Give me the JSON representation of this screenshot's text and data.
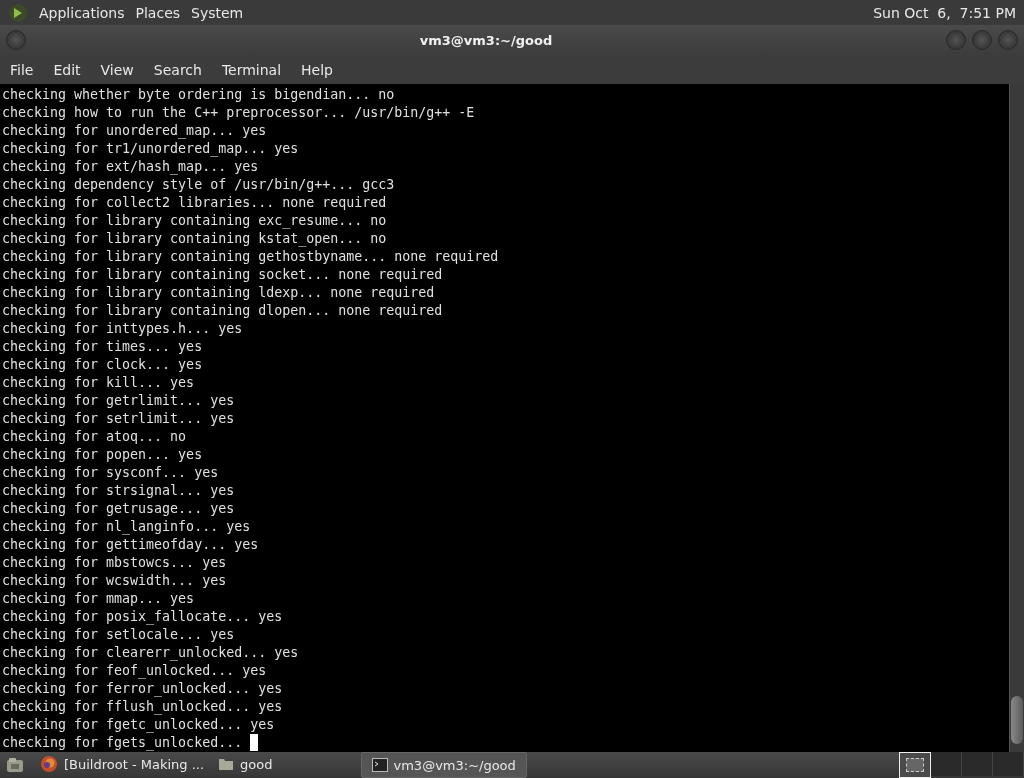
{
  "top_panel": {
    "menus": [
      "Applications",
      "Places",
      "System"
    ],
    "clock": "Sun Oct  6,  7:51 PM"
  },
  "window": {
    "title": "vm3@vm3:~/good"
  },
  "menu_bar": [
    "File",
    "Edit",
    "View",
    "Search",
    "Terminal",
    "Help"
  ],
  "terminal": {
    "cursor_visible": true,
    "lines": [
      "checking whether byte ordering is bigendian... no",
      "checking how to run the C++ preprocessor... /usr/bin/g++ -E",
      "checking for unordered_map... yes",
      "checking for tr1/unordered_map... yes",
      "checking for ext/hash_map... yes",
      "checking dependency style of /usr/bin/g++... gcc3",
      "checking for collect2 libraries... none required",
      "checking for library containing exc_resume... no",
      "checking for library containing kstat_open... no",
      "checking for library containing gethostbyname... none required",
      "checking for library containing socket... none required",
      "checking for library containing ldexp... none required",
      "checking for library containing dlopen... none required",
      "checking for inttypes.h... yes",
      "checking for times... yes",
      "checking for clock... yes",
      "checking for kill... yes",
      "checking for getrlimit... yes",
      "checking for setrlimit... yes",
      "checking for atoq... no",
      "checking for popen... yes",
      "checking for sysconf... yes",
      "checking for strsignal... yes",
      "checking for getrusage... yes",
      "checking for nl_langinfo... yes",
      "checking for gettimeofday... yes",
      "checking for mbstowcs... yes",
      "checking for wcswidth... yes",
      "checking for mmap... yes",
      "checking for posix_fallocate... yes",
      "checking for setlocale... yes",
      "checking for clearerr_unlocked... yes",
      "checking for feof_unlocked... yes",
      "checking for ferror_unlocked... yes",
      "checking for fflush_unlocked... yes",
      "checking for fgetc_unlocked... yes",
      "checking for fgets_unlocked... "
    ]
  },
  "taskbar": {
    "tasks": [
      {
        "kind": "browser",
        "label": "[Buildroot - Making ...",
        "selected": false
      },
      {
        "kind": "folder",
        "label": "good",
        "selected": false
      },
      {
        "kind": "terminal",
        "label": "vm3@vm3:~/good",
        "selected": true
      }
    ],
    "workspaces": [
      {
        "selected": true
      },
      {
        "selected": false
      },
      {
        "selected": false
      },
      {
        "selected": false
      }
    ]
  }
}
